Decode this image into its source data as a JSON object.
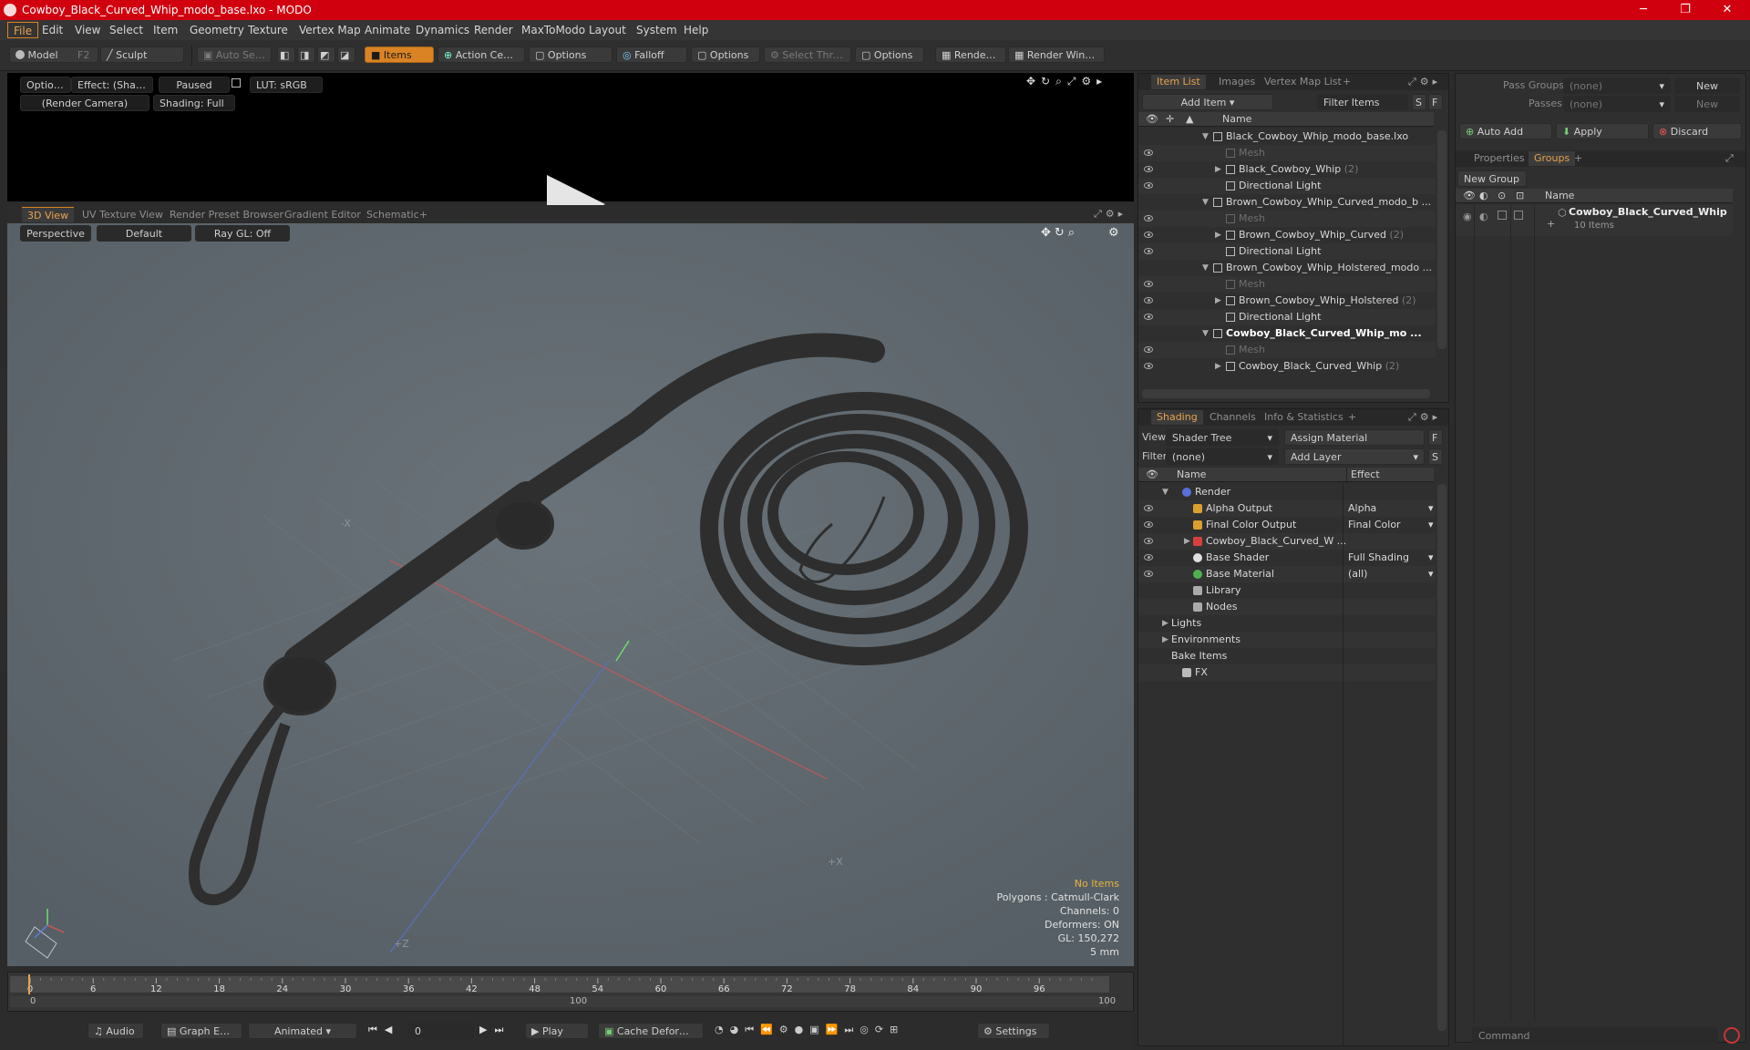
{
  "titlebar": {
    "title": "Cowboy_Black_Curved_Whip_modo_base.lxo - MODO",
    "minimize": "─",
    "maximize": "❐",
    "close": "✕"
  },
  "menu": [
    "File",
    "Edit",
    "View",
    "Select",
    "Item",
    "Geometry",
    "Texture",
    "Vertex Map",
    "Animate",
    "Dynamics",
    "Render",
    "MaxToModo",
    "Layout",
    "System",
    "Help"
  ],
  "toolbar": {
    "model": "Model",
    "model_key": "F2",
    "sculpt": "Sculpt",
    "auto_select": "Auto Select",
    "items": "Items",
    "action_center": "Action Center",
    "options1": "Options",
    "falloff": "Falloff",
    "options2": "Options",
    "select_through": "Select Through",
    "options3": "Options",
    "render": "Render",
    "render_key": "F9",
    "render_window": "Render Window"
  },
  "render_preview": {
    "options": "Options",
    "effect": "Effect: (Shadi...",
    "status": "Paused",
    "lut": "LUT: sRGB",
    "camera": "(Render Camera)",
    "shading": "Shading: Full"
  },
  "view_tabs": [
    "3D View",
    "UV Texture View",
    "Render Preset Browser",
    "Gradient Editor",
    "Schematic",
    "+"
  ],
  "viewport": {
    "perspective": "Perspective",
    "default": "Default",
    "raygl": "Ray GL: Off",
    "axis_x_neg": "-X",
    "axis_x_pos": "+X",
    "axis_z": "+Z",
    "stats": {
      "selection": "No Items",
      "polygons": "Polygons : Catmull-Clark",
      "channels": "Channels: 0",
      "deformers": "Deformers: ON",
      "gl": "GL: 150,272",
      "unit": "5 mm"
    }
  },
  "timeline": {
    "ticks": [
      "0",
      "6",
      "12",
      "18",
      "24",
      "30",
      "36",
      "42",
      "48",
      "54",
      "60",
      "66",
      "72",
      "78",
      "84",
      "90",
      "96"
    ],
    "range_start": "0",
    "range_mid": "100",
    "range_end": "100"
  },
  "bottombar": {
    "audio": "Audio",
    "graph_editor": "Graph Editor",
    "mode": "Animated",
    "frame": "0",
    "play": "Play",
    "cache": "Cache Deformers",
    "settings": "Settings"
  },
  "item_list": {
    "tabs": [
      "Item List",
      "Images",
      "Vertex Map List",
      "+"
    ],
    "add_item": "Add Item",
    "filter": "Filter Items",
    "btn_s": "S",
    "btn_f": "F",
    "col_name": "Name",
    "rows": [
      {
        "label": "Black_Cowboy_Whip_modo_base.lxo",
        "count": "",
        "type": "scene",
        "indent": 0,
        "bold": false,
        "dim": false
      },
      {
        "label": "Mesh",
        "count": "",
        "type": "mesh",
        "indent": 1,
        "bold": false,
        "dim": true
      },
      {
        "label": "Black_Cowboy_Whip",
        "count": "(2)",
        "type": "group",
        "indent": 1,
        "bold": false,
        "dim": false
      },
      {
        "label": "Directional Light",
        "count": "",
        "type": "light",
        "indent": 1,
        "bold": false,
        "dim": false
      },
      {
        "label": "Brown_Cowboy_Whip_Curved_modo_b ...",
        "count": "",
        "type": "scene",
        "indent": 0,
        "bold": false,
        "dim": false
      },
      {
        "label": "Mesh",
        "count": "",
        "type": "mesh",
        "indent": 1,
        "bold": false,
        "dim": true
      },
      {
        "label": "Brown_Cowboy_Whip_Curved",
        "count": "(2)",
        "type": "group",
        "indent": 1,
        "bold": false,
        "dim": false
      },
      {
        "label": "Directional Light",
        "count": "",
        "type": "light",
        "indent": 1,
        "bold": false,
        "dim": false
      },
      {
        "label": "Brown_Cowboy_Whip_Holstered_modo ...",
        "count": "",
        "type": "scene",
        "indent": 0,
        "bold": false,
        "dim": false
      },
      {
        "label": "Mesh",
        "count": "",
        "type": "mesh",
        "indent": 1,
        "bold": false,
        "dim": true
      },
      {
        "label": "Brown_Cowboy_Whip_Holstered",
        "count": "(2)",
        "type": "group",
        "indent": 1,
        "bold": false,
        "dim": false
      },
      {
        "label": "Directional Light",
        "count": "",
        "type": "light",
        "indent": 1,
        "bold": false,
        "dim": false
      },
      {
        "label": "Cowboy_Black_Curved_Whip_mo ...",
        "count": "",
        "type": "scene",
        "indent": 0,
        "bold": true,
        "dim": false
      },
      {
        "label": "Mesh",
        "count": "",
        "type": "mesh",
        "indent": 1,
        "bold": false,
        "dim": true
      },
      {
        "label": "Cowboy_Black_Curved_Whip",
        "count": "(2)",
        "type": "group",
        "indent": 1,
        "bold": false,
        "dim": false
      }
    ]
  },
  "shading": {
    "tabs": [
      "Shading",
      "Channels",
      "Info & Statistics",
      "+"
    ],
    "view_label": "View",
    "view_value": "Shader Tree",
    "assign": "Assign Material",
    "filter_label": "Filter",
    "filter_value": "(none)",
    "add_layer": "Add Layer",
    "btn_f": "F",
    "btn_s": "S",
    "col_name": "Name",
    "col_effect": "Effect",
    "rows": [
      {
        "label": "Render",
        "effect": "",
        "indent": 0,
        "icon": "render-icon",
        "eye": false
      },
      {
        "label": "Alpha Output",
        "effect": "Alpha",
        "indent": 1,
        "icon": "output-icon",
        "eye": true
      },
      {
        "label": "Final Color Output",
        "effect": "Final Color",
        "indent": 1,
        "icon": "output-icon",
        "eye": true
      },
      {
        "label": "Cowboy_Black_Curved_W ...",
        "effect": "",
        "indent": 1,
        "icon": "material-group-icon",
        "eye": true
      },
      {
        "label": "Base Shader",
        "effect": "Full Shading",
        "indent": 1,
        "icon": "shader-icon",
        "eye": true
      },
      {
        "label": "Base Material",
        "effect": "(all)",
        "indent": 1,
        "icon": "material-icon",
        "eye": true
      },
      {
        "label": "Library",
        "effect": "",
        "indent": 1,
        "icon": "folder-icon",
        "eye": false
      },
      {
        "label": "Nodes",
        "effect": "",
        "indent": 1,
        "icon": "folder-icon",
        "eye": false
      },
      {
        "label": "Lights",
        "effect": "",
        "indent": 0,
        "icon": "",
        "eye": false
      },
      {
        "label": "Environments",
        "effect": "",
        "indent": 0,
        "icon": "",
        "eye": false
      },
      {
        "label": "Bake Items",
        "effect": "",
        "indent": 0,
        "icon": "",
        "eye": false
      },
      {
        "label": "FX",
        "effect": "",
        "indent": 0,
        "icon": "fx-icon",
        "eye": false
      }
    ]
  },
  "groups_panel": {
    "pass_groups_label": "Pass Groups",
    "pass_groups_value": "(none)",
    "new": "New",
    "passes_label": "Passes",
    "passes_value": "(none)",
    "new2": "New",
    "auto_add": "Auto Add",
    "apply": "Apply",
    "discard": "Discard",
    "tabs": [
      "Properties",
      "Groups",
      "+"
    ],
    "new_group": "New Group",
    "col_name": "Name",
    "group_name": "Cowboy_Black_Curved_Whip ...",
    "group_count": "10 Items"
  },
  "command": {
    "placeholder": "Command"
  }
}
